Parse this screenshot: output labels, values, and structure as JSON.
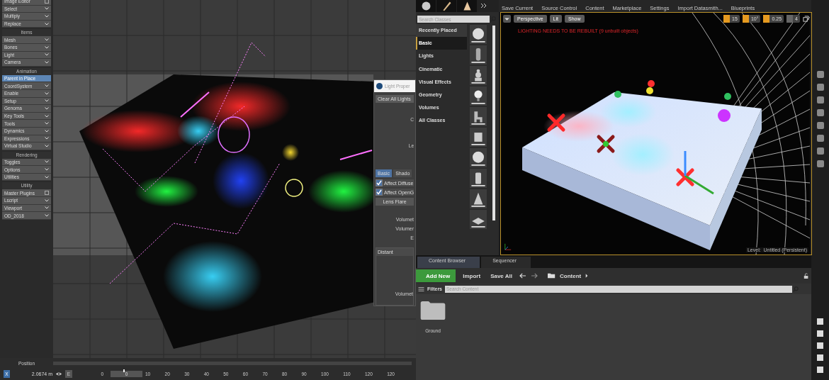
{
  "lightwave": {
    "menu_groups": [
      {
        "items": [
          {
            "label": "Image Editor",
            "kind": "square",
            "selected": false
          },
          {
            "label": "Select",
            "kind": "dropdown",
            "selected": false
          },
          {
            "label": "Multiply",
            "kind": "dropdown",
            "selected": false
          },
          {
            "label": "Replace",
            "kind": "dropdown",
            "selected": false
          }
        ]
      },
      {
        "title": "Items",
        "items": [
          {
            "label": "Mesh",
            "kind": "dropdown",
            "selected": false
          },
          {
            "label": "Bones",
            "kind": "dropdown",
            "selected": false
          },
          {
            "label": "Light",
            "kind": "dropdown",
            "selected": false
          },
          {
            "label": "Camera",
            "kind": "dropdown",
            "selected": false
          }
        ]
      },
      {
        "title": "Animation",
        "items": [
          {
            "label": "Parent in Place",
            "kind": "plain",
            "selected": true
          },
          {
            "label": "CoordSystem",
            "kind": "dropdown",
            "selected": false
          },
          {
            "label": "Enable",
            "kind": "dropdown",
            "selected": false
          },
          {
            "label": "Setup",
            "kind": "dropdown",
            "selected": false
          },
          {
            "label": "Genoma",
            "kind": "dropdown",
            "selected": false
          },
          {
            "label": "Key Tools",
            "kind": "dropdown",
            "selected": false
          },
          {
            "label": "Tools",
            "kind": "dropdown",
            "selected": false
          },
          {
            "label": "Dynamics",
            "kind": "dropdown",
            "selected": false
          },
          {
            "label": "Expressions",
            "kind": "dropdown",
            "selected": false
          },
          {
            "label": "Virtual Studio",
            "kind": "dropdown",
            "selected": false
          }
        ]
      },
      {
        "title": "Rendering",
        "items": [
          {
            "label": "Toggles",
            "kind": "dropdown",
            "selected": false
          },
          {
            "label": "Options",
            "kind": "dropdown",
            "selected": false
          },
          {
            "label": "Utilities",
            "kind": "dropdown",
            "selected": false
          }
        ]
      },
      {
        "title": "Utility",
        "items": [
          {
            "label": "Master Plugins",
            "kind": "square",
            "selected": false
          },
          {
            "label": "Lscript",
            "kind": "dropdown",
            "selected": false
          },
          {
            "label": "Viewport",
            "kind": "dropdown",
            "selected": false
          },
          {
            "label": "OD_2018",
            "kind": "dropdown",
            "selected": false
          }
        ]
      }
    ],
    "light_properties": {
      "title": "Light Proper",
      "clear_button": "Clear All Lights",
      "labels_top": [
        "C",
        "Le"
      ],
      "tabs": [
        {
          "label": "Basic",
          "selected": true
        },
        {
          "label": "Shado",
          "selected": false
        }
      ],
      "checkboxes": [
        {
          "label": "Affect Diffuse",
          "checked": true
        },
        {
          "label": "Affect OpenG",
          "checked": true
        }
      ],
      "lens_flare_button": "Lens Flare",
      "labels_mid": [
        "Volumet",
        "Volumer",
        "E"
      ],
      "type_dropdown": "Distant",
      "labels_bottom": [
        "Volumet"
      ]
    },
    "timeline": {
      "label": "Position",
      "axis": "X",
      "value": "2.0674 m",
      "key_button": "E",
      "start": "0",
      "frame_slider": {
        "value": "0",
        "level": 0.4
      },
      "ticks": [
        "10",
        "20",
        "30",
        "40",
        "50",
        "60",
        "70",
        "80",
        "90",
        "100",
        "110",
        "120",
        "120"
      ]
    }
  },
  "unreal": {
    "toolbar": [
      "Save Current",
      "Source Control",
      "Content",
      "Marketplace",
      "Settings",
      "Import Datasmith...",
      "Blueprints"
    ],
    "place": {
      "search_placeholder": "Search Classes",
      "categories": [
        {
          "label": "Recently Placed",
          "selected": false
        },
        {
          "label": "Basic",
          "selected": true
        },
        {
          "label": "Lights",
          "selected": false
        },
        {
          "label": "Cinematic",
          "selected": false
        },
        {
          "label": "Visual Effects",
          "selected": false
        },
        {
          "label": "Geometry",
          "selected": false
        },
        {
          "label": "Volumes",
          "selected": false
        },
        {
          "label": "All Classes",
          "selected": false
        }
      ]
    },
    "viewport": {
      "buttons": [
        "Perspective",
        "Lit",
        "Show"
      ],
      "snaps": [
        {
          "value": "15",
          "on": true
        },
        {
          "value": "10°",
          "on": true
        },
        {
          "value": "0.25",
          "on": true
        },
        {
          "value": "4",
          "on": false
        }
      ],
      "warning": "LIGHTING NEEDS TO BE REBUILT (9 unbuilt objects)",
      "level_label": "Level:  Untitled (Persistent)"
    },
    "content_browser": {
      "tabs": [
        {
          "label": "Content Browser",
          "selected": true
        },
        {
          "label": "Sequencer",
          "selected": false
        }
      ],
      "add_new": "Add New",
      "import": "Import",
      "save_all": "Save All",
      "path": "Content",
      "filters": "Filters",
      "search_placeholder": "Search Content",
      "items": [
        {
          "name": "Ground"
        }
      ]
    }
  }
}
